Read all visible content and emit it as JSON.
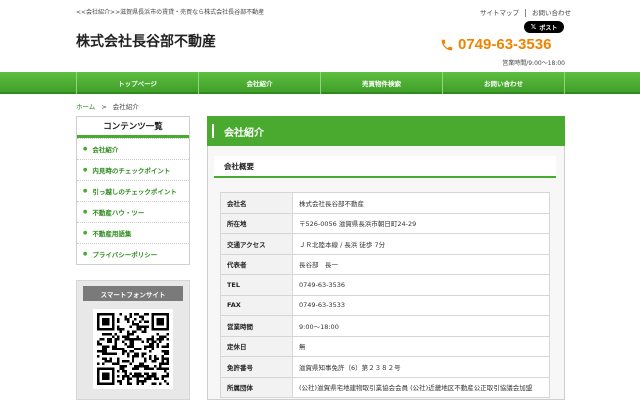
{
  "header": {
    "tagline": "<<会社紹介>>滋賀県長浜市の賃貸・売買なら株式会社長谷部不動産",
    "top_links": [
      "サイトマップ",
      "お問い合わせ"
    ],
    "x_post_label": "ポスト",
    "site_title": "株式会社長谷部不動産",
    "phone": "0749-63-3536",
    "hours": "営業時間/9:00～18:00",
    "accent_color": "#f08300"
  },
  "nav": {
    "items": [
      "トップページ",
      "会社紹介",
      "売買物件検索",
      "お問い合わせ"
    ],
    "color": "#4aaa30"
  },
  "breadcrumb": {
    "home": "ホーム",
    "separator": ">",
    "current": "会社紹介"
  },
  "sidebar": {
    "title": "コンテンツ一覧",
    "items": [
      "会社紹介",
      "内見時のチェックポイント",
      "引っ越しのチェックポイント",
      "不動産ハウ・ツー",
      "不動産用語集",
      "プライバシーポリシー"
    ],
    "smartphone_title": "スマートフォンサイト"
  },
  "main": {
    "title": "会社紹介",
    "section_title": "会社概要",
    "table": [
      {
        "label": "会社名",
        "value": "株式会社長谷部不動産"
      },
      {
        "label": "所在地",
        "value": "〒526-0056 滋賀県長浜市朝日町24-29"
      },
      {
        "label": "交通アクセス",
        "value": "ＪＲ北陸本線 / 長浜 徒歩 7分"
      },
      {
        "label": "代表者",
        "value": "長谷部　長一"
      },
      {
        "label": "TEL",
        "value": "0749-63-3536"
      },
      {
        "label": "FAX",
        "value": "0749-63-3533"
      },
      {
        "label": "営業時間",
        "value": "9:00～18:00"
      },
      {
        "label": "定休日",
        "value": "無"
      },
      {
        "label": "免許番号",
        "value": "滋賀県知事免許（6）第２３８２号"
      },
      {
        "label": "所属団体",
        "value": "(公社)滋賀県宅地建物取引業協会会員 (公社)近畿地区不動産公正取引協議会加盟"
      }
    ]
  }
}
